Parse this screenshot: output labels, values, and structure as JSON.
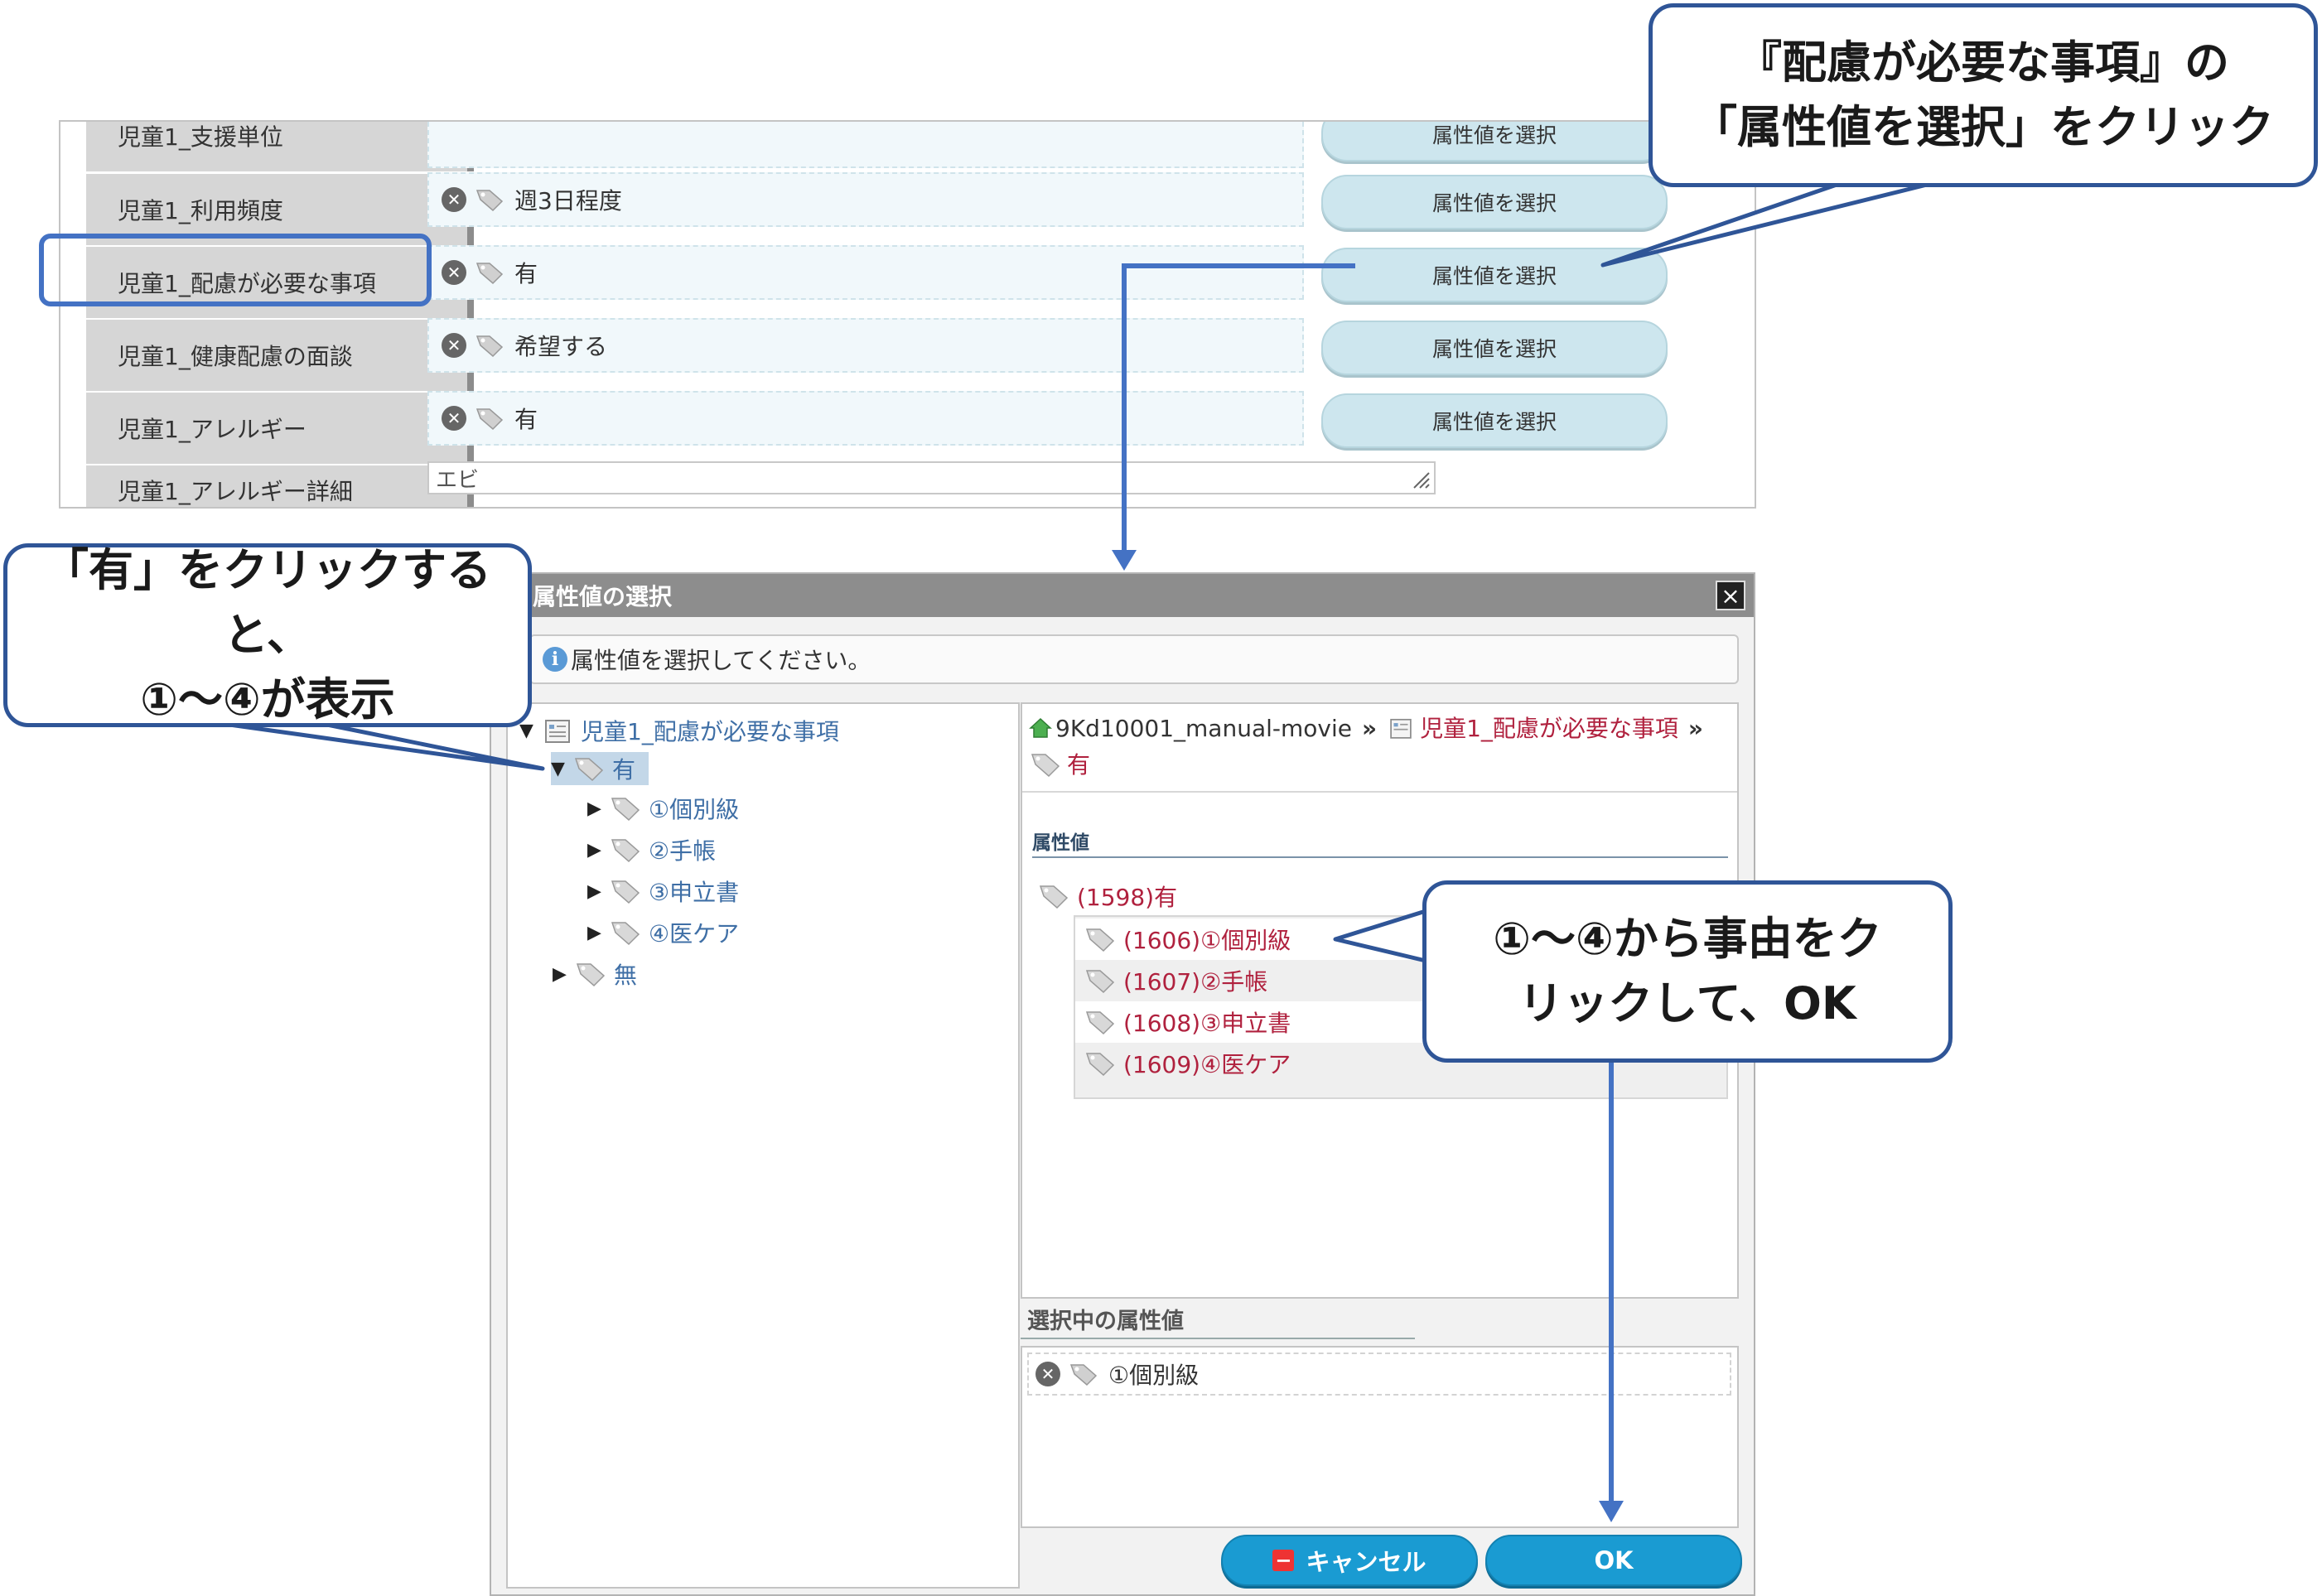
{
  "form": {
    "rows": [
      {
        "label": "児童1_支援単位",
        "value": "",
        "button": "属性値を選択"
      },
      {
        "label": "児童1_利用頻度",
        "value": "週3日程度",
        "button": "属性値を選択"
      },
      {
        "label": "児童1_配慮が必要な事項",
        "value": "有",
        "button": "属性値を選択"
      },
      {
        "label": "児童1_健康配慮の面談",
        "value": "希望する",
        "button": "属性値を選択"
      },
      {
        "label": "児童1_アレルギー",
        "value": "有",
        "button": "属性値を選択"
      },
      {
        "label": "児童1_アレルギー詳細",
        "value": "エビ"
      }
    ]
  },
  "dialog": {
    "title": "属性値の選択",
    "close_label": "×",
    "info_icon": "i",
    "info_text": "属性値を選択してください。",
    "tree": {
      "root": "児童1_配慮が必要な事項",
      "yes": "有",
      "children": [
        "①個別級",
        "②手帳",
        "③申立書",
        "④医ケア"
      ],
      "no": "無"
    },
    "breadcrumb": {
      "home": "9Kd10001_manual-movie",
      "sep": "»",
      "item": "児童1_配慮が必要な事項",
      "current": "有"
    },
    "attributes_heading": "属性値",
    "attribute_root": "(1598)有",
    "attribute_items": [
      "(1606)①個別級",
      "(1607)②手帳",
      "(1608)③申立書",
      "(1609)④医ケア"
    ],
    "selected_heading": "選択中の属性値",
    "selected_value": "①個別級",
    "cancel_label": "キャンセル",
    "ok_label": "OK"
  },
  "callouts": {
    "c1_line1": "『配慮が必要な事項』の",
    "c1_line2": "「属性値を選択」をクリック",
    "c2_line1": "「有」をクリックすると、",
    "c2_line2": "①～④が表示",
    "c3_line1": "①～④から事由をク",
    "c3_line2": "リックして、OK"
  },
  "colors": {
    "accent_blue": "#4472c4",
    "callout_border": "#2f5597",
    "link_red": "#b0213e",
    "tree_blue": "#3f6fa6",
    "button_blue": "#1a9bd2",
    "form_button": "#cde6ee"
  },
  "icons": [
    "remove-icon",
    "tag-icon",
    "folder-icon",
    "home-icon",
    "info-icon",
    "close-icon",
    "minus-icon",
    "resize-grip-icon"
  ]
}
